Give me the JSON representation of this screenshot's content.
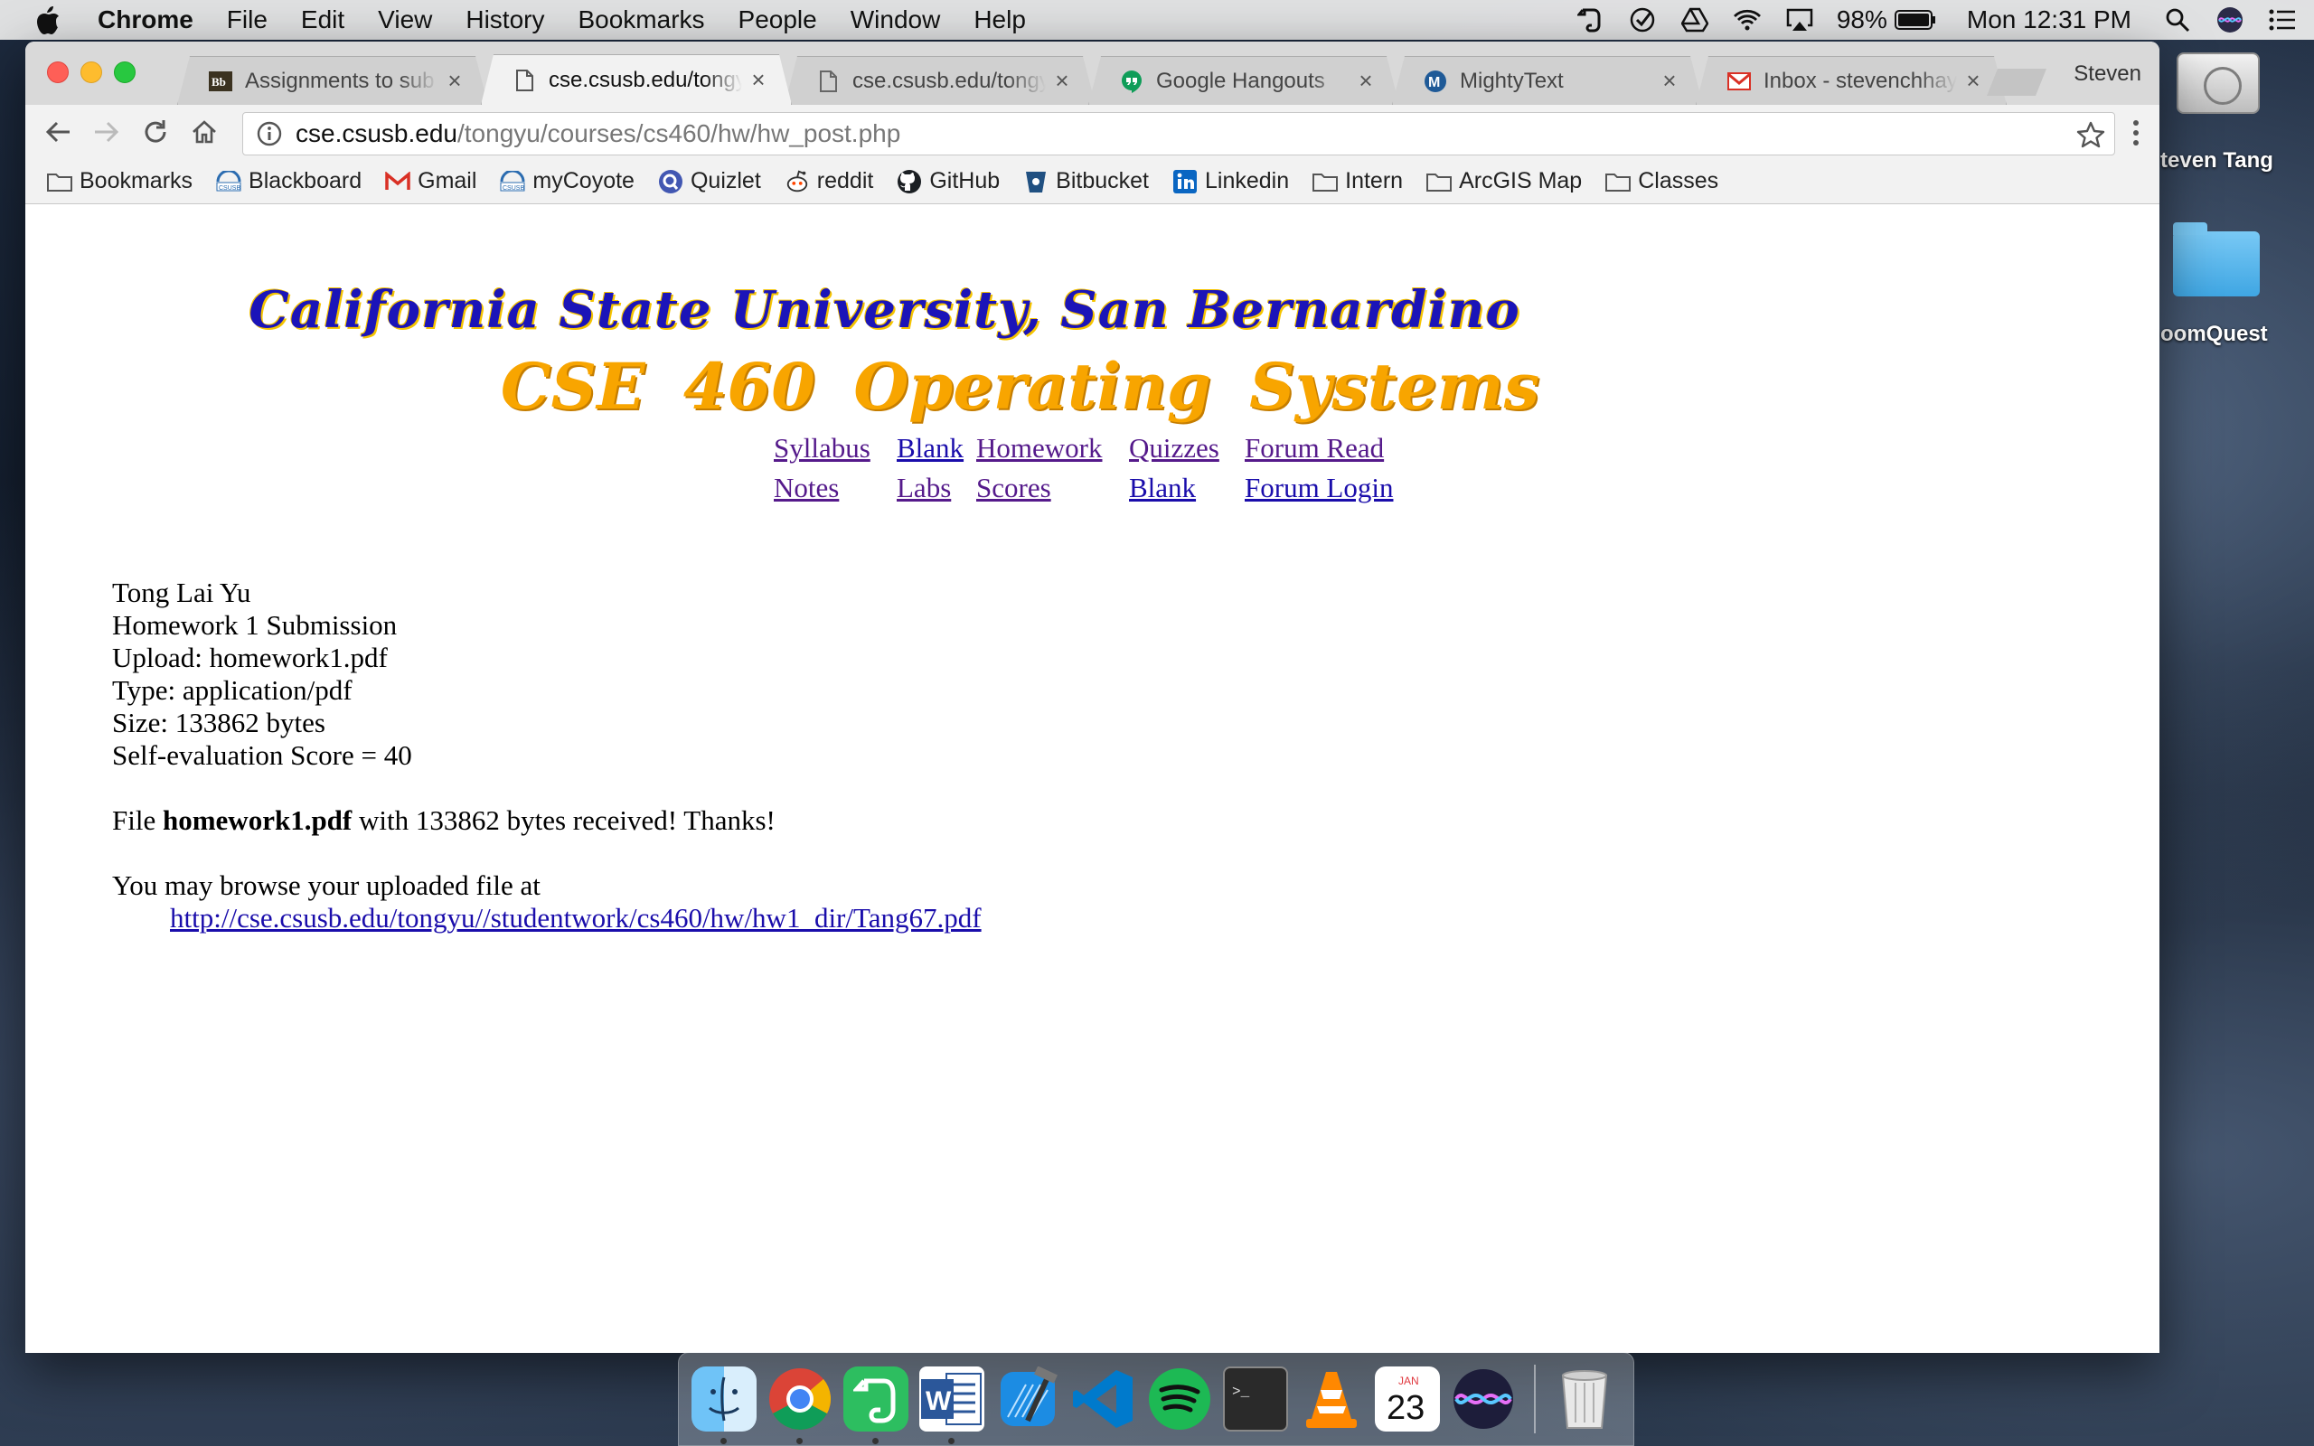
{
  "menubar": {
    "app_name": "Chrome",
    "menus": [
      "File",
      "Edit",
      "View",
      "History",
      "Bookmarks",
      "People",
      "Window",
      "Help"
    ],
    "battery": "98%",
    "clock": "Mon 12:31 PM"
  },
  "desktop": {
    "drive_label": "teven Tang",
    "folder_label": "oomQuest"
  },
  "tabs": [
    {
      "title": "Assignments to sub",
      "icon": "blackboard-icon",
      "active": false
    },
    {
      "title": "cse.csusb.edu/tongyu",
      "icon": "page-icon",
      "active": true
    },
    {
      "title": "cse.csusb.edu/tongyu",
      "icon": "page-icon",
      "active": false
    },
    {
      "title": "Google Hangouts",
      "icon": "hangouts-icon",
      "active": false
    },
    {
      "title": "MightyText",
      "icon": "mightytext-icon",
      "active": false
    },
    {
      "title": "Inbox - stevenchhay",
      "icon": "gmail-icon",
      "active": false
    }
  ],
  "profile_name": "Steven",
  "address": {
    "host": "cse.csusb.edu",
    "path": "/tongyu/courses/cs460/hw/hw_post.php"
  },
  "bookmarks": [
    {
      "label": "Bookmarks",
      "icon": "folder-icon"
    },
    {
      "label": "Blackboard",
      "icon": "csusb-icon"
    },
    {
      "label": "Gmail",
      "icon": "gmail-icon"
    },
    {
      "label": "myCoyote",
      "icon": "csusb-icon"
    },
    {
      "label": "Quizlet",
      "icon": "quizlet-icon"
    },
    {
      "label": "reddit",
      "icon": "reddit-icon"
    },
    {
      "label": "GitHub",
      "icon": "github-icon"
    },
    {
      "label": "Bitbucket",
      "icon": "bitbucket-icon"
    },
    {
      "label": "Linkedin",
      "icon": "linkedin-icon"
    },
    {
      "label": "Intern",
      "icon": "folder-icon"
    },
    {
      "label": "ArcGIS Map",
      "icon": "folder-icon"
    },
    {
      "label": "Classes",
      "icon": "folder-icon"
    }
  ],
  "page": {
    "university_title": "California State University, San Bernardino",
    "course_title": "CSE 460   Operating Systems",
    "nav": {
      "syllabus": "Syllabus",
      "blank1": "Blank",
      "homework": "Homework",
      "quizzes": "Quizzes",
      "forum_read": "Forum Read",
      "notes": "Notes",
      "labs": "Labs",
      "scores": "Scores",
      "blank2": "Blank",
      "forum_login": "Forum Login"
    },
    "submission": {
      "name": "Tong Lai Yu",
      "title": "Homework 1 Submission",
      "upload": "Upload: homework1.pdf",
      "type": "Type: application/pdf",
      "size": "Size: 133862 bytes",
      "score": "Self-evaluation Score = 40",
      "received_prefix": "File",
      "received_file": "homework1.pdf",
      "received_suffix": "with 133862 bytes received! Thanks!",
      "browse_text": "You may browse your uploaded file at",
      "file_url": "http://cse.csusb.edu/tongyu//studentwork/cs460/hw/hw1_dir/Tang67.pdf"
    }
  },
  "dock": {
    "apps": [
      "finder-icon",
      "chrome-icon",
      "evernote-icon",
      "word-icon",
      "xcode-icon",
      "vscode-icon",
      "spotify-icon",
      "terminal-icon",
      "vlc-icon",
      "calendar-icon",
      "siri-icon"
    ],
    "calendar_month": "JAN",
    "calendar_day": "23"
  },
  "colors": {
    "link": "#1a0dab",
    "visited_link": "#551a8b",
    "univ_title": "#1b14b8",
    "course_title": "#f8a500"
  }
}
